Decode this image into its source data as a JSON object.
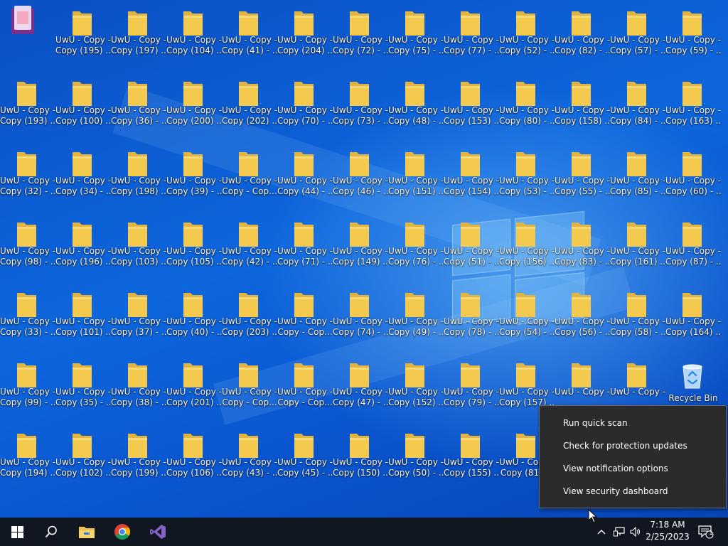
{
  "desktop": {
    "top_left_icon_label": "",
    "folders": [
      [
        "",
        "UwU - Copy - Copy (195) ...",
        "UwU - Copy - Copy (197) ...",
        "UwU - Copy - Copy (104) ...",
        "UwU - Copy - Copy (41) - ...",
        "UwU - Copy - Copy (204) ...",
        "UwU - Copy - Copy (72) - ...",
        "UwU - Copy - Copy (75) - ...",
        "UwU - Copy - Copy (77) - ...",
        "UwU - Copy - Copy (52) - ...",
        "UwU - Copy - Copy (82) - ...",
        "UwU - Copy - Copy (57) - ...",
        "UwU - Copy - Copy (59) - ..."
      ],
      [
        "UwU - Copy - Copy (193) ...",
        "UwU - Copy - Copy (100) ...",
        "UwU - Copy - Copy (36) - ...",
        "UwU - Copy - Copy (200) ...",
        "UwU - Copy - Copy (202) ...",
        "UwU - Copy - Copy (70) - ...",
        "UwU - Copy - Copy (73) - ...",
        "UwU - Copy - Copy (48) - ...",
        "UwU - Copy - Copy (153) ...",
        "UwU - Copy - Copy (80) - ...",
        "UwU - Copy - Copy (158) ...",
        "UwU - Copy - Copy (84) - ...",
        "UwU - Copy - Copy (163) ..."
      ],
      [
        "UwU - Copy - Copy (32) - ...",
        "UwU - Copy - Copy (34) - ...",
        "UwU - Copy - Copy (198) ...",
        "UwU - Copy - Copy (39) - ...",
        "UwU - Copy - Copy - Cop...",
        "UwU - Copy - Copy (44) - ...",
        "UwU - Copy - Copy (46) - ...",
        "UwU - Copy - Copy (151) ...",
        "UwU - Copy - Copy (154) ...",
        "UwU - Copy - Copy (53) - ...",
        "UwU - Copy - Copy (55) - ...",
        "UwU - Copy - Copy (85) - ...",
        "UwU - Copy - Copy (60) - ..."
      ],
      [
        "UwU - Copy - Copy (98) - ...",
        "UwU - Copy - Copy (196) ...",
        "UwU - Copy - Copy (103) ...",
        "UwU - Copy - Copy (105) ...",
        "UwU - Copy - Copy (42) - ...",
        "UwU - Copy - Copy (71) - ...",
        "UwU - Copy - Copy (149) ...",
        "UwU - Copy - Copy (76) - ...",
        "UwU - Copy - Copy (51) - ...",
        "UwU - Copy - Copy (156) ...",
        "UwU - Copy - Copy (83) - ...",
        "UwU - Copy - Copy (161) ...",
        "UwU - Copy - Copy (87) - ..."
      ],
      [
        "UwU - Copy - Copy (33) - ...",
        "UwU - Copy - Copy (101) ...",
        "UwU - Copy - Copy (37) - ...",
        "UwU - Copy - Copy (40) - ...",
        "UwU - Copy - Copy (203) ...",
        "UwU - Copy - Copy - Cop...",
        "UwU - Copy - Copy (74) - ...",
        "UwU - Copy - Copy (49) - ...",
        "UwU - Copy - Copy (78) - ...",
        "UwU - Copy - Copy (54) - ...",
        "UwU - Copy - Copy (56) - ...",
        "UwU - Copy - Copy (58) - ...",
        "UwU - Copy - Copy (164) ..."
      ],
      [
        "UwU - Copy - Copy (99) - ...",
        "UwU - Copy - Copy (35) - ...",
        "UwU - Copy - Copy (38) - ...",
        "UwU - Copy - Copy (201) ...",
        "UwU - Copy - Copy - Cop...",
        "UwU - Copy - Copy - Cop...",
        "UwU - Copy - Copy (47) - ...",
        "UwU - Copy - Copy (152) ...",
        "UwU - Copy - Copy (79) - ...",
        "UwU - Copy - Copy (157) ...",
        "UwU - Copy -",
        "UwU - Copy -"
      ],
      [
        "UwU - Copy - Copy (194) ...",
        "UwU - Copy - Copy (102) ...",
        "UwU - Copy - Copy (199) ...",
        "UwU - Copy - Copy (106) ...",
        "UwU - Copy - Copy (43) - ...",
        "UwU - Copy - Copy (45) - ...",
        "UwU - Copy - Copy (150) ...",
        "UwU - Copy - Copy (50) - ...",
        "UwU - Copy - Copy (155) ...",
        "UwU - Copy - Copy (81) ..."
      ]
    ],
    "recycle_bin_label": "Recycle Bin"
  },
  "context_menu": {
    "items": [
      "Run quick scan",
      "Check for protection updates",
      "View notification options",
      "View security dashboard"
    ]
  },
  "taskbar": {
    "icons": [
      "windows-start-icon",
      "search-icon",
      "file-explorer-icon",
      "chrome-icon",
      "visual-studio-icon"
    ],
    "tray_icons": [
      "chevron-up-icon",
      "network-icon",
      "volume-icon"
    ],
    "time": "7:18 AM",
    "date": "2/25/2023",
    "notification_count": "1"
  },
  "colors": {
    "taskbar_bg": "#101720",
    "menu_bg": "#2b2b2b",
    "folder": "#f3c94e",
    "desktop": "#0a5bd0"
  }
}
